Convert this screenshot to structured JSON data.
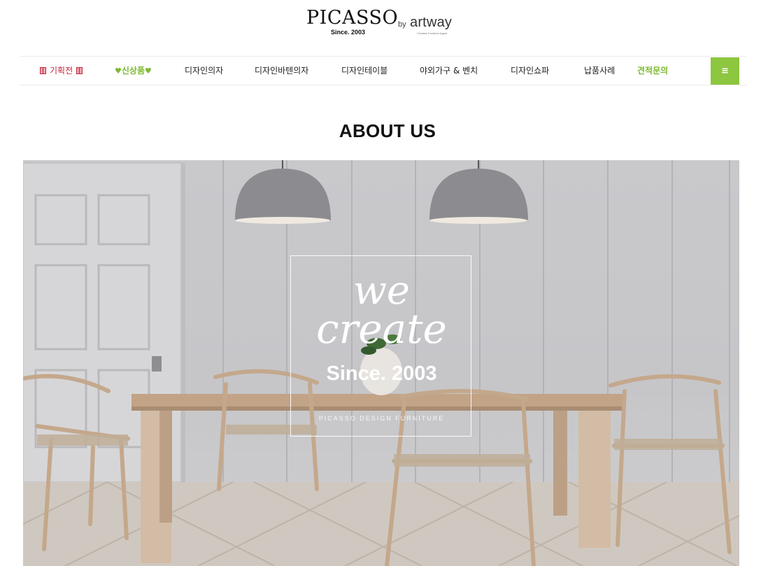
{
  "logo": {
    "brand": "PICASSO",
    "since": "Since. 2003",
    "by": "by",
    "partner": "artway",
    "partner_tag": "Creative Furniture Agent"
  },
  "nav": {
    "items": [
      {
        "label": "기획전",
        "kind": "promo"
      },
      {
        "label": "신상품",
        "kind": "new"
      },
      {
        "label": "디자인의자",
        "kind": "normal"
      },
      {
        "label": "디자인바텐의자",
        "kind": "normal"
      },
      {
        "label": "디자인테이블",
        "kind": "normal"
      },
      {
        "label": "야외가구 & 벤치",
        "kind": "normal"
      },
      {
        "label": "디자인쇼파",
        "kind": "normal"
      },
      {
        "label": "납품사례",
        "kind": "normal"
      },
      {
        "label": "견적문의",
        "kind": "quote"
      }
    ],
    "menu_icon": "≡",
    "accent_color": "#8dc63f",
    "promo_color": "#c8263c"
  },
  "page": {
    "title": "ABOUT US"
  },
  "hero": {
    "script_line1": "we",
    "script_line2": "create",
    "since": "Since. 2003",
    "subtitle": "PICASSO DESIGN FURNITURE"
  }
}
